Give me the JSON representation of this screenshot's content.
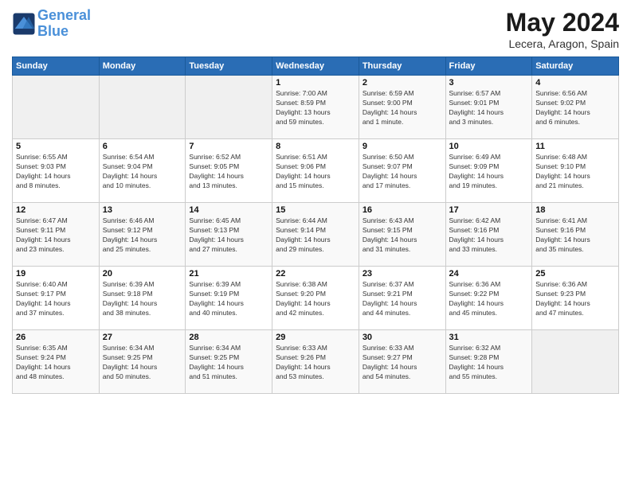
{
  "header": {
    "logo_line1": "General",
    "logo_line2": "Blue",
    "month": "May 2024",
    "location": "Lecera, Aragon, Spain"
  },
  "days_of_week": [
    "Sunday",
    "Monday",
    "Tuesday",
    "Wednesday",
    "Thursday",
    "Friday",
    "Saturday"
  ],
  "weeks": [
    [
      {
        "day": "",
        "info": ""
      },
      {
        "day": "",
        "info": ""
      },
      {
        "day": "",
        "info": ""
      },
      {
        "day": "1",
        "info": "Sunrise: 7:00 AM\nSunset: 8:59 PM\nDaylight: 13 hours\nand 59 minutes."
      },
      {
        "day": "2",
        "info": "Sunrise: 6:59 AM\nSunset: 9:00 PM\nDaylight: 14 hours\nand 1 minute."
      },
      {
        "day": "3",
        "info": "Sunrise: 6:57 AM\nSunset: 9:01 PM\nDaylight: 14 hours\nand 3 minutes."
      },
      {
        "day": "4",
        "info": "Sunrise: 6:56 AM\nSunset: 9:02 PM\nDaylight: 14 hours\nand 6 minutes."
      }
    ],
    [
      {
        "day": "5",
        "info": "Sunrise: 6:55 AM\nSunset: 9:03 PM\nDaylight: 14 hours\nand 8 minutes."
      },
      {
        "day": "6",
        "info": "Sunrise: 6:54 AM\nSunset: 9:04 PM\nDaylight: 14 hours\nand 10 minutes."
      },
      {
        "day": "7",
        "info": "Sunrise: 6:52 AM\nSunset: 9:05 PM\nDaylight: 14 hours\nand 13 minutes."
      },
      {
        "day": "8",
        "info": "Sunrise: 6:51 AM\nSunset: 9:06 PM\nDaylight: 14 hours\nand 15 minutes."
      },
      {
        "day": "9",
        "info": "Sunrise: 6:50 AM\nSunset: 9:07 PM\nDaylight: 14 hours\nand 17 minutes."
      },
      {
        "day": "10",
        "info": "Sunrise: 6:49 AM\nSunset: 9:09 PM\nDaylight: 14 hours\nand 19 minutes."
      },
      {
        "day": "11",
        "info": "Sunrise: 6:48 AM\nSunset: 9:10 PM\nDaylight: 14 hours\nand 21 minutes."
      }
    ],
    [
      {
        "day": "12",
        "info": "Sunrise: 6:47 AM\nSunset: 9:11 PM\nDaylight: 14 hours\nand 23 minutes."
      },
      {
        "day": "13",
        "info": "Sunrise: 6:46 AM\nSunset: 9:12 PM\nDaylight: 14 hours\nand 25 minutes."
      },
      {
        "day": "14",
        "info": "Sunrise: 6:45 AM\nSunset: 9:13 PM\nDaylight: 14 hours\nand 27 minutes."
      },
      {
        "day": "15",
        "info": "Sunrise: 6:44 AM\nSunset: 9:14 PM\nDaylight: 14 hours\nand 29 minutes."
      },
      {
        "day": "16",
        "info": "Sunrise: 6:43 AM\nSunset: 9:15 PM\nDaylight: 14 hours\nand 31 minutes."
      },
      {
        "day": "17",
        "info": "Sunrise: 6:42 AM\nSunset: 9:16 PM\nDaylight: 14 hours\nand 33 minutes."
      },
      {
        "day": "18",
        "info": "Sunrise: 6:41 AM\nSunset: 9:16 PM\nDaylight: 14 hours\nand 35 minutes."
      }
    ],
    [
      {
        "day": "19",
        "info": "Sunrise: 6:40 AM\nSunset: 9:17 PM\nDaylight: 14 hours\nand 37 minutes."
      },
      {
        "day": "20",
        "info": "Sunrise: 6:39 AM\nSunset: 9:18 PM\nDaylight: 14 hours\nand 38 minutes."
      },
      {
        "day": "21",
        "info": "Sunrise: 6:39 AM\nSunset: 9:19 PM\nDaylight: 14 hours\nand 40 minutes."
      },
      {
        "day": "22",
        "info": "Sunrise: 6:38 AM\nSunset: 9:20 PM\nDaylight: 14 hours\nand 42 minutes."
      },
      {
        "day": "23",
        "info": "Sunrise: 6:37 AM\nSunset: 9:21 PM\nDaylight: 14 hours\nand 44 minutes."
      },
      {
        "day": "24",
        "info": "Sunrise: 6:36 AM\nSunset: 9:22 PM\nDaylight: 14 hours\nand 45 minutes."
      },
      {
        "day": "25",
        "info": "Sunrise: 6:36 AM\nSunset: 9:23 PM\nDaylight: 14 hours\nand 47 minutes."
      }
    ],
    [
      {
        "day": "26",
        "info": "Sunrise: 6:35 AM\nSunset: 9:24 PM\nDaylight: 14 hours\nand 48 minutes."
      },
      {
        "day": "27",
        "info": "Sunrise: 6:34 AM\nSunset: 9:25 PM\nDaylight: 14 hours\nand 50 minutes."
      },
      {
        "day": "28",
        "info": "Sunrise: 6:34 AM\nSunset: 9:25 PM\nDaylight: 14 hours\nand 51 minutes."
      },
      {
        "day": "29",
        "info": "Sunrise: 6:33 AM\nSunset: 9:26 PM\nDaylight: 14 hours\nand 53 minutes."
      },
      {
        "day": "30",
        "info": "Sunrise: 6:33 AM\nSunset: 9:27 PM\nDaylight: 14 hours\nand 54 minutes."
      },
      {
        "day": "31",
        "info": "Sunrise: 6:32 AM\nSunset: 9:28 PM\nDaylight: 14 hours\nand 55 minutes."
      },
      {
        "day": "",
        "info": ""
      }
    ]
  ]
}
